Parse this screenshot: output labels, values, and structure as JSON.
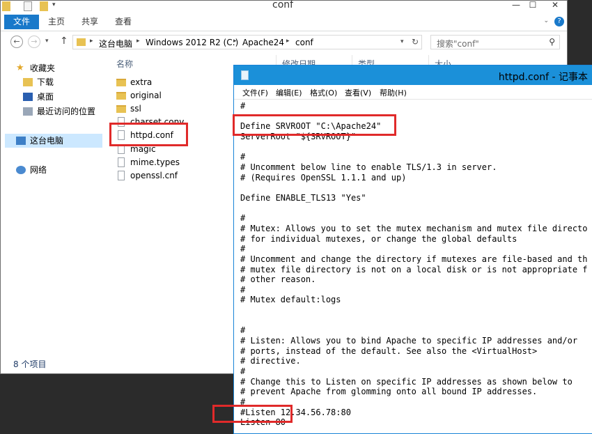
{
  "explorer": {
    "title": "conf",
    "tabs": [
      "文件",
      "主页",
      "共享",
      "查看"
    ],
    "breadcrumb": [
      "这台电脑",
      "Windows 2012 R2 (C:)",
      "Apache24",
      "conf"
    ],
    "search_placeholder": "搜索\"conf\"",
    "nav": {
      "favorites": "收藏夹",
      "downloads": "下载",
      "desktop": "桌面",
      "recent": "最近访问的位置",
      "this_pc": "这台电脑",
      "network": "网络"
    },
    "columns": [
      "名称",
      "修改日期",
      "类型",
      "大小"
    ],
    "files": [
      {
        "name": "extra",
        "kind": "folder"
      },
      {
        "name": "original",
        "kind": "folder"
      },
      {
        "name": "ssl",
        "kind": "folder"
      },
      {
        "name": "charset.conv",
        "kind": "file"
      },
      {
        "name": "httpd.conf",
        "kind": "file"
      },
      {
        "name": "magic",
        "kind": "file"
      },
      {
        "name": "mime.types",
        "kind": "file"
      },
      {
        "name": "openssl.cnf",
        "kind": "file"
      }
    ],
    "status": "8 个项目"
  },
  "notepad": {
    "title": "httpd.conf - 记事本",
    "menu": [
      "文件(F)",
      "编辑(E)",
      "格式(O)",
      "查看(V)",
      "帮助(H)"
    ],
    "lines": [
      "#",
      "",
      "Define SRVROOT \"C:\\Apache24\"",
      "ServerRoot \"${SRVROOT}\"",
      "",
      "#",
      "# Uncomment below line to enable TLS/1.3 in server.",
      "# (Requires OpenSSL 1.1.1 and up)",
      "",
      "Define ENABLE_TLS13 \"Yes\"",
      "",
      "#",
      "# Mutex: Allows you to set the mutex mechanism and mutex file directo",
      "# for individual mutexes, or change the global defaults",
      "#",
      "# Uncomment and change the directory if mutexes are file-based and th",
      "# mutex file directory is not on a local disk or is not appropriate f",
      "# other reason.",
      "#",
      "# Mutex default:logs",
      "",
      "",
      "#",
      "# Listen: Allows you to bind Apache to specific IP addresses and/or",
      "# ports, instead of the default. See also the <VirtualHost>",
      "# directive.",
      "#",
      "# Change this to Listen on specific IP addresses as shown below to",
      "# prevent Apache from glomming onto all bound IP addresses.",
      "#",
      "#Listen 12.34.56.78:80",
      "Listen 80",
      "",
      "#"
    ]
  },
  "colors": {
    "highlight": "#e02a2a",
    "notepad_titlebar": "#1b90d9",
    "ribbon_file_tab": "#1979ca",
    "selection": "#cce8ff"
  }
}
